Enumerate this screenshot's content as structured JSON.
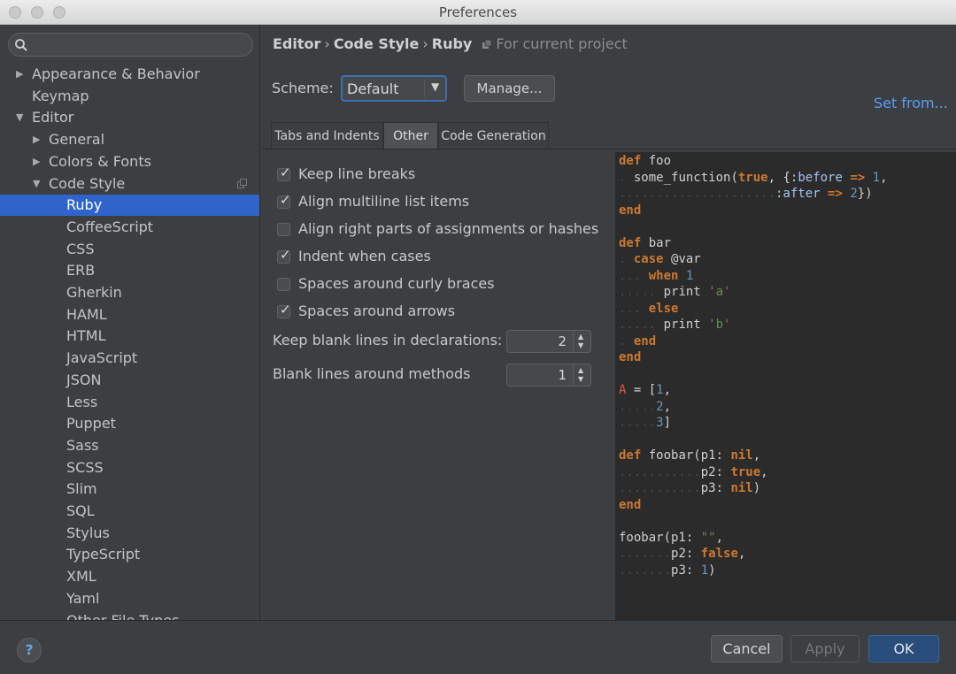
{
  "window": {
    "title": "Preferences"
  },
  "sidebar": {
    "search_placeholder": "",
    "tree": [
      {
        "label": "Appearance & Behavior",
        "expanded": false,
        "has_arrow": true
      },
      {
        "label": "Keymap",
        "has_arrow": false
      },
      {
        "label": "Editor",
        "expanded": true,
        "has_arrow": true
      },
      {
        "label": "General",
        "expanded": false,
        "has_arrow": true
      },
      {
        "label": "Colors & Fonts",
        "expanded": false,
        "has_arrow": true
      },
      {
        "label": "Code Style",
        "expanded": true,
        "has_arrow": true
      },
      {
        "label": "Ruby",
        "selected": true
      },
      {
        "label": "CoffeeScript"
      },
      {
        "label": "CSS"
      },
      {
        "label": "ERB"
      },
      {
        "label": "Gherkin"
      },
      {
        "label": "HAML"
      },
      {
        "label": "HTML"
      },
      {
        "label": "JavaScript"
      },
      {
        "label": "JSON"
      },
      {
        "label": "Less"
      },
      {
        "label": "Puppet"
      },
      {
        "label": "Sass"
      },
      {
        "label": "SCSS"
      },
      {
        "label": "Slim"
      },
      {
        "label": "SQL"
      },
      {
        "label": "Stylus"
      },
      {
        "label": "TypeScript"
      },
      {
        "label": "XML"
      },
      {
        "label": "Yaml"
      },
      {
        "label": "Other File Types"
      }
    ]
  },
  "breadcrumb": {
    "items": [
      "Editor",
      "Code Style",
      "Ruby"
    ],
    "separator": "›",
    "scope_label": "For current project"
  },
  "scheme": {
    "label": "Scheme:",
    "value": "Default",
    "manage_label": "Manage...",
    "set_from_label": "Set from..."
  },
  "tabs": [
    {
      "label": "Tabs and Indents",
      "active": false
    },
    {
      "label": "Other",
      "active": true
    },
    {
      "label": "Code Generation",
      "active": false
    }
  ],
  "options": [
    {
      "label": "Keep line breaks",
      "checked": true
    },
    {
      "label": "Align multiline list items",
      "checked": true
    },
    {
      "label": "Align right parts of assignments or hashes",
      "checked": false
    },
    {
      "label": "Indent when cases",
      "checked": true
    },
    {
      "label": "Spaces around curly braces",
      "checked": false
    },
    {
      "label": "Spaces around arrows",
      "checked": true
    }
  ],
  "spinners": [
    {
      "label": "Keep blank lines in declarations:",
      "value": "2"
    },
    {
      "label": "Blank lines around methods",
      "value": "1"
    }
  ],
  "code_preview": [
    [
      [
        "kw",
        "def"
      ],
      [
        "t",
        " foo"
      ]
    ],
    [
      [
        "d",
        "."
      ],
      [
        "t",
        " some_function("
      ],
      [
        "kw",
        "true"
      ],
      [
        "t",
        ", {"
      ],
      [
        "sym",
        ":before"
      ],
      [
        "t",
        " "
      ],
      [
        "kw",
        "=>"
      ],
      [
        "t",
        " "
      ],
      [
        "num",
        "1"
      ],
      [
        "t",
        ","
      ]
    ],
    [
      [
        "d",
        "....................."
      ],
      [
        "sym",
        ":after"
      ],
      [
        "t",
        " "
      ],
      [
        "kw",
        "=>"
      ],
      [
        "t",
        " "
      ],
      [
        "num",
        "2"
      ],
      [
        "t",
        "})"
      ]
    ],
    [
      [
        "kw",
        "end"
      ]
    ],
    [],
    [
      [
        "kw",
        "def"
      ],
      [
        "t",
        " bar"
      ]
    ],
    [
      [
        "d",
        "."
      ],
      [
        "t",
        " "
      ],
      [
        "kw",
        "case"
      ],
      [
        "t",
        " @var"
      ]
    ],
    [
      [
        "d",
        "..."
      ],
      [
        "t",
        " "
      ],
      [
        "kw",
        "when"
      ],
      [
        "t",
        " "
      ],
      [
        "num",
        "1"
      ]
    ],
    [
      [
        "d",
        "....."
      ],
      [
        "t",
        " print "
      ],
      [
        "str",
        "'a'"
      ]
    ],
    [
      [
        "d",
        "..."
      ],
      [
        "t",
        " "
      ],
      [
        "kw",
        "else"
      ]
    ],
    [
      [
        "d",
        "....."
      ],
      [
        "t",
        " print "
      ],
      [
        "str",
        "'b'"
      ]
    ],
    [
      [
        "d",
        "."
      ],
      [
        "t",
        " "
      ],
      [
        "kw",
        "end"
      ]
    ],
    [
      [
        "kw",
        "end"
      ]
    ],
    [],
    [
      [
        "c",
        "A"
      ],
      [
        "t",
        " = ["
      ],
      [
        "num",
        "1"
      ],
      [
        "t",
        ","
      ]
    ],
    [
      [
        "d",
        "....."
      ],
      [
        "num",
        "2"
      ],
      [
        "t",
        ","
      ]
    ],
    [
      [
        "d",
        "....."
      ],
      [
        "num",
        "3"
      ],
      [
        "t",
        "]"
      ]
    ],
    [],
    [
      [
        "kw",
        "def"
      ],
      [
        "t",
        " foobar(p1: "
      ],
      [
        "kw",
        "nil"
      ],
      [
        "t",
        ","
      ]
    ],
    [
      [
        "d",
        "..........."
      ],
      [
        "t",
        "p2: "
      ],
      [
        "kw",
        "true"
      ],
      [
        "t",
        ","
      ]
    ],
    [
      [
        "d",
        "..........."
      ],
      [
        "t",
        "p3: "
      ],
      [
        "kw",
        "nil"
      ],
      [
        "t",
        ")"
      ]
    ],
    [
      [
        "kw",
        "end"
      ]
    ],
    [],
    [
      [
        "t",
        "foobar(p1: "
      ],
      [
        "str",
        "\"\""
      ],
      [
        "t",
        ","
      ]
    ],
    [
      [
        "d",
        "......."
      ],
      [
        "t",
        "p2: "
      ],
      [
        "kw",
        "false"
      ],
      [
        "t",
        ","
      ]
    ],
    [
      [
        "d",
        "......."
      ],
      [
        "t",
        "p3: "
      ],
      [
        "num",
        "1"
      ],
      [
        "t",
        ")"
      ]
    ]
  ],
  "footer": {
    "help_label": "?",
    "cancel_label": "Cancel",
    "apply_label": "Apply",
    "ok_label": "OK"
  }
}
